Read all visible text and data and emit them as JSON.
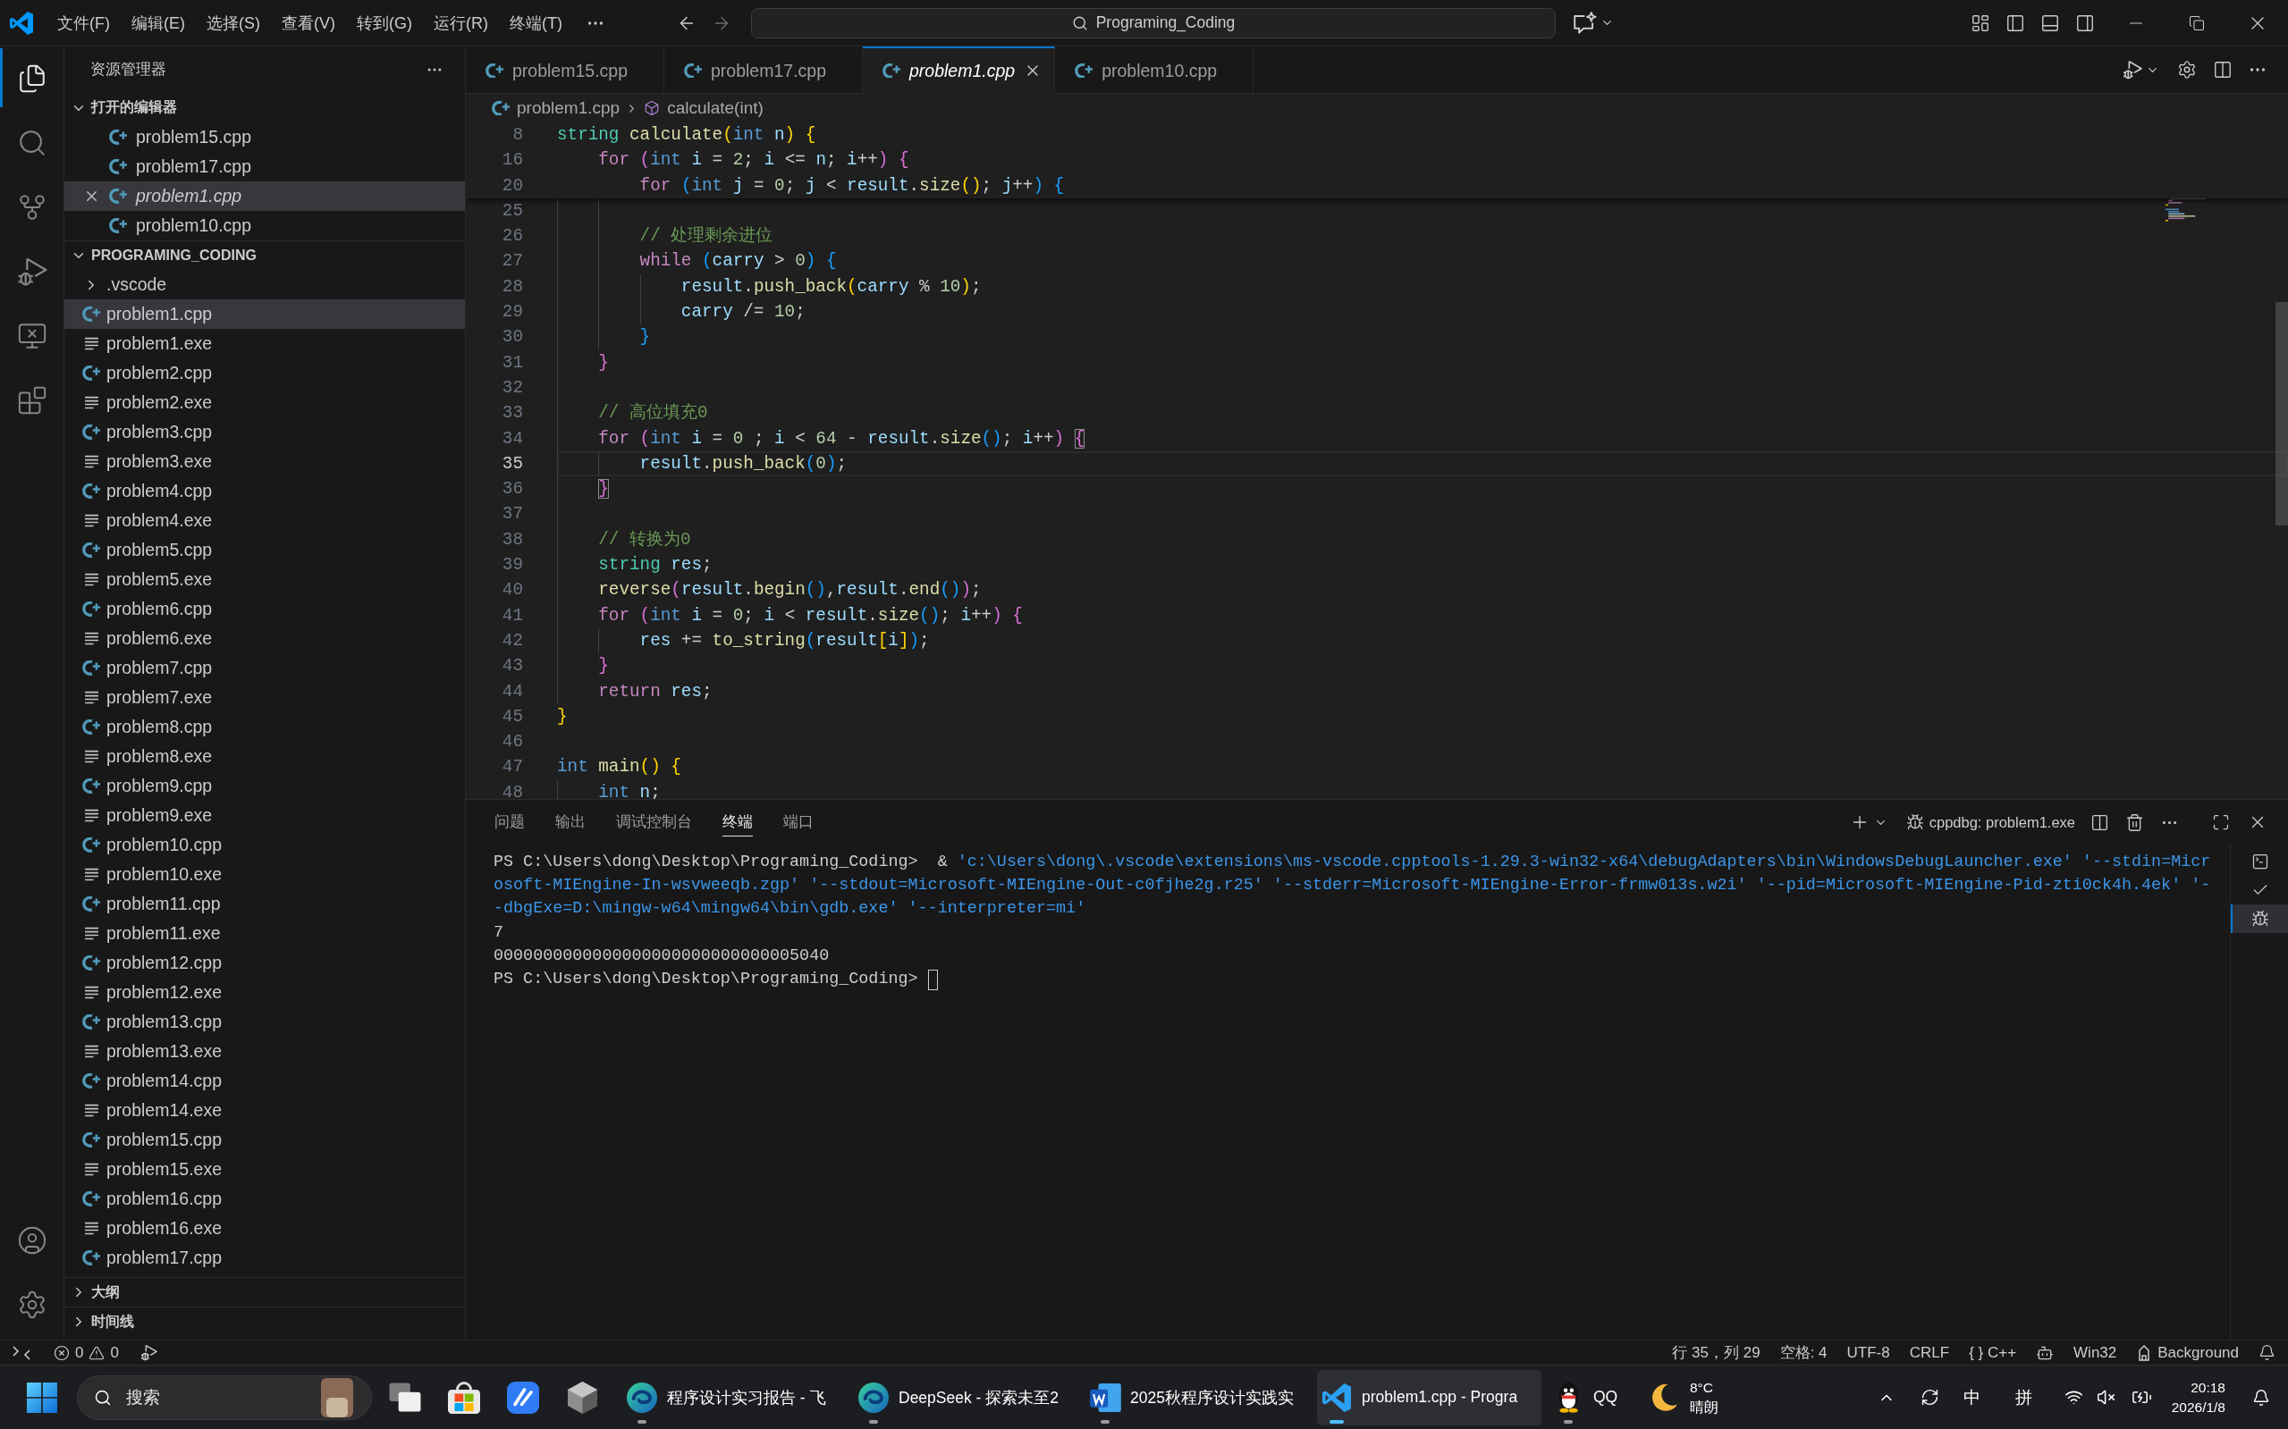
{
  "title_bar": {
    "menus": [
      "文件(F)",
      "编辑(E)",
      "选择(S)",
      "查看(V)",
      "转到(G)",
      "运行(R)",
      "终端(T)"
    ],
    "search": {
      "value": "Programing_Coding"
    }
  },
  "activity_bar": {
    "top": [
      {
        "kind": "explorer",
        "selected": true
      },
      {
        "kind": "search",
        "selected": false
      },
      {
        "kind": "source_control",
        "selected": false
      },
      {
        "kind": "run_debug",
        "selected": false
      },
      {
        "kind": "remote_explorer",
        "selected": false
      },
      {
        "kind": "extensions",
        "selected": false
      }
    ],
    "bottom": [
      {
        "kind": "accounts"
      },
      {
        "kind": "settings"
      }
    ]
  },
  "sidebar": {
    "title": "资源管理器",
    "open_editors": {
      "title": "打开的编辑器",
      "expanded": true,
      "items": [
        {
          "name": "problem15.cpp",
          "selected": false,
          "preview": false
        },
        {
          "name": "problem17.cpp",
          "selected": false,
          "preview": false
        },
        {
          "name": "problem1.cpp",
          "selected": true,
          "preview": true
        },
        {
          "name": "problem10.cpp",
          "selected": false,
          "preview": false
        }
      ]
    },
    "folder": {
      "title": "PROGRAMING_CODING",
      "expanded": true,
      "children": [
        {
          "name": ".vscode",
          "kind": "folder",
          "expanded": false,
          "selected": false
        },
        {
          "name": "problem1.cpp",
          "kind": "cpp",
          "selected": true
        },
        {
          "name": "problem1.exe",
          "kind": "exe",
          "selected": false
        },
        {
          "name": "problem2.cpp",
          "kind": "cpp",
          "selected": false
        },
        {
          "name": "problem2.exe",
          "kind": "exe",
          "selected": false
        },
        {
          "name": "problem3.cpp",
          "kind": "cpp",
          "selected": false
        },
        {
          "name": "problem3.exe",
          "kind": "exe",
          "selected": false
        },
        {
          "name": "problem4.cpp",
          "kind": "cpp",
          "selected": false
        },
        {
          "name": "problem4.exe",
          "kind": "exe",
          "selected": false
        },
        {
          "name": "problem5.cpp",
          "kind": "cpp",
          "selected": false
        },
        {
          "name": "problem5.exe",
          "kind": "exe",
          "selected": false
        },
        {
          "name": "problem6.cpp",
          "kind": "cpp",
          "selected": false
        },
        {
          "name": "problem6.exe",
          "kind": "exe",
          "selected": false
        },
        {
          "name": "problem7.cpp",
          "kind": "cpp",
          "selected": false
        },
        {
          "name": "problem7.exe",
          "kind": "exe",
          "selected": false
        },
        {
          "name": "problem8.cpp",
          "kind": "cpp",
          "selected": false
        },
        {
          "name": "problem8.exe",
          "kind": "exe",
          "selected": false
        },
        {
          "name": "problem9.cpp",
          "kind": "cpp",
          "selected": false
        },
        {
          "name": "problem9.exe",
          "kind": "exe",
          "selected": false
        },
        {
          "name": "problem10.cpp",
          "kind": "cpp",
          "selected": false
        },
        {
          "name": "problem10.exe",
          "kind": "exe",
          "selected": false
        },
        {
          "name": "problem11.cpp",
          "kind": "cpp",
          "selected": false
        },
        {
          "name": "problem11.exe",
          "kind": "exe",
          "selected": false
        },
        {
          "name": "problem12.cpp",
          "kind": "cpp",
          "selected": false
        },
        {
          "name": "problem12.exe",
          "kind": "exe",
          "selected": false
        },
        {
          "name": "problem13.cpp",
          "kind": "cpp",
          "selected": false
        },
        {
          "name": "problem13.exe",
          "kind": "exe",
          "selected": false
        },
        {
          "name": "problem14.cpp",
          "kind": "cpp",
          "selected": false
        },
        {
          "name": "problem14.exe",
          "kind": "exe",
          "selected": false
        },
        {
          "name": "problem15.cpp",
          "kind": "cpp",
          "selected": false
        },
        {
          "name": "problem15.exe",
          "kind": "exe",
          "selected": false
        },
        {
          "name": "problem16.cpp",
          "kind": "cpp",
          "selected": false
        },
        {
          "name": "problem16.exe",
          "kind": "exe",
          "selected": false
        },
        {
          "name": "problem17.cpp",
          "kind": "cpp",
          "selected": false
        }
      ]
    },
    "sections": [
      {
        "title": "大纲",
        "expanded": false
      },
      {
        "title": "时间线",
        "expanded": false
      }
    ]
  },
  "editor": {
    "tabs": [
      {
        "name": "problem15.cpp",
        "selected": false,
        "preview": false
      },
      {
        "name": "problem17.cpp",
        "selected": false,
        "preview": false
      },
      {
        "name": "problem1.cpp",
        "selected": true,
        "preview": true
      },
      {
        "name": "problem10.cpp",
        "selected": false,
        "preview": false
      }
    ],
    "breadcrumb": [
      {
        "kind": "file",
        "text": "problem1.cpp"
      },
      {
        "kind": "symbol",
        "text": "calculate(int)"
      }
    ],
    "sticky_lines": [
      {
        "number": "8",
        "current": false,
        "tokens": [
          {
            "text": "string ",
            "kind": "class"
          },
          {
            "text": "calculate",
            "kind": "function"
          },
          {
            "text": "(",
            "kind": "bracket1"
          },
          {
            "text": "int ",
            "kind": "type"
          },
          {
            "text": "n",
            "kind": "variable"
          },
          {
            "text": ") {",
            "kind": "bracket1"
          }
        ]
      },
      {
        "number": "16",
        "current": false,
        "tokens": [
          {
            "text": "    for ",
            "kind": "keyword"
          },
          {
            "text": "(",
            "kind": "bracket2"
          },
          {
            "text": "int ",
            "kind": "type"
          },
          {
            "text": "i",
            "kind": "variable"
          },
          {
            "text": " = ",
            "kind": "plain"
          },
          {
            "text": "2",
            "kind": "number"
          },
          {
            "text": "; ",
            "kind": "plain"
          },
          {
            "text": "i",
            "kind": "variable"
          },
          {
            "text": " <= ",
            "kind": "plain"
          },
          {
            "text": "n",
            "kind": "variable"
          },
          {
            "text": "; ",
            "kind": "plain"
          },
          {
            "text": "i",
            "kind": "variable"
          },
          {
            "text": "++",
            "kind": "plain"
          },
          {
            "text": ") {",
            "kind": "bracket2"
          }
        ]
      },
      {
        "number": "20",
        "current": false,
        "tokens": [
          {
            "text": "        for ",
            "kind": "keyword"
          },
          {
            "text": "(",
            "kind": "bracket3"
          },
          {
            "text": "int ",
            "kind": "type"
          },
          {
            "text": "j",
            "kind": "variable"
          },
          {
            "text": " = ",
            "kind": "plain"
          },
          {
            "text": "0",
            "kind": "number"
          },
          {
            "text": "; ",
            "kind": "plain"
          },
          {
            "text": "j",
            "kind": "variable"
          },
          {
            "text": " < ",
            "kind": "plain"
          },
          {
            "text": "result",
            "kind": "variable"
          },
          {
            "text": ".",
            "kind": "plain"
          },
          {
            "text": "size",
            "kind": "function"
          },
          {
            "text": "()",
            "kind": "bracket1"
          },
          {
            "text": "; ",
            "kind": "plain"
          },
          {
            "text": "j",
            "kind": "variable"
          },
          {
            "text": "++",
            "kind": "plain"
          },
          {
            "text": ") {",
            "kind": "bracket3"
          }
        ]
      }
    ],
    "lines": [
      {
        "number": "25",
        "current": false
      },
      {
        "number": "26",
        "current": false,
        "tokens": [
          {
            "text": "        // 处理剩余进位",
            "kind": "comment"
          }
        ]
      },
      {
        "number": "27",
        "current": false,
        "tokens": [
          {
            "text": "        while ",
            "kind": "keyword"
          },
          {
            "text": "(",
            "kind": "bracket3"
          },
          {
            "text": "carry",
            "kind": "variable"
          },
          {
            "text": " > ",
            "kind": "plain"
          },
          {
            "text": "0",
            "kind": "number"
          },
          {
            "text": ") {",
            "kind": "bracket3"
          }
        ]
      },
      {
        "number": "28",
        "current": false,
        "tokens": [
          {
            "text": "            result",
            "kind": "variable"
          },
          {
            "text": ".",
            "kind": "plain"
          },
          {
            "text": "push_back",
            "kind": "function"
          },
          {
            "text": "(",
            "kind": "bracket1"
          },
          {
            "text": "carry",
            "kind": "variable"
          },
          {
            "text": " % ",
            "kind": "plain"
          },
          {
            "text": "10",
            "kind": "number"
          },
          {
            "text": ")",
            "kind": "bracket1"
          },
          {
            "text": ";",
            "kind": "plain"
          }
        ]
      },
      {
        "number": "29",
        "current": false,
        "tokens": [
          {
            "text": "            carry",
            "kind": "variable"
          },
          {
            "text": " /= ",
            "kind": "plain"
          },
          {
            "text": "10",
            "kind": "number"
          },
          {
            "text": ";",
            "kind": "plain"
          }
        ]
      },
      {
        "number": "30",
        "current": false,
        "tokens": [
          {
            "text": "        }",
            "kind": "bracket3"
          }
        ]
      },
      {
        "number": "31",
        "current": false,
        "tokens": [
          {
            "text": "    }",
            "kind": "bracket2"
          }
        ]
      },
      {
        "number": "32",
        "current": false
      },
      {
        "number": "33",
        "current": false,
        "tokens": [
          {
            "text": "    // 高位填充0",
            "kind": "comment"
          }
        ]
      },
      {
        "number": "34",
        "current": false,
        "tokens": [
          {
            "text": "    for ",
            "kind": "keyword"
          },
          {
            "text": "(",
            "kind": "bracket2"
          },
          {
            "text": "int ",
            "kind": "type"
          },
          {
            "text": "i",
            "kind": "variable"
          },
          {
            "text": " = ",
            "kind": "plain"
          },
          {
            "text": "0",
            "kind": "number"
          },
          {
            "text": " ; ",
            "kind": "plain"
          },
          {
            "text": "i",
            "kind": "variable"
          },
          {
            "text": " < ",
            "kind": "plain"
          },
          {
            "text": "64",
            "kind": "number"
          },
          {
            "text": " - ",
            "kind": "plain"
          },
          {
            "text": "result",
            "kind": "variable"
          },
          {
            "text": ".",
            "kind": "plain"
          },
          {
            "text": "size",
            "kind": "function"
          },
          {
            "text": "()",
            "kind": "bracket3"
          },
          {
            "text": "; ",
            "kind": "plain"
          },
          {
            "text": "i",
            "kind": "variable"
          },
          {
            "text": "++",
            "kind": "plain"
          },
          {
            "text": ") ",
            "kind": "bracket2"
          },
          {
            "text": "{",
            "kind": "bracket2_match"
          }
        ]
      },
      {
        "number": "35",
        "current": true,
        "tokens": [
          {
            "text": "        result",
            "kind": "variable"
          },
          {
            "text": ".",
            "kind": "plain"
          },
          {
            "text": "push_back",
            "kind": "function"
          },
          {
            "text": "(",
            "kind": "bracket3"
          },
          {
            "text": "0",
            "kind": "number"
          },
          {
            "text": ")",
            "kind": "bracket3"
          },
          {
            "text": ";",
            "kind": "plain"
          }
        ]
      },
      {
        "number": "36",
        "current": false,
        "tokens": [
          {
            "text": "    }",
            "kind": "bracket2_match"
          }
        ]
      },
      {
        "number": "37",
        "current": false
      },
      {
        "number": "38",
        "current": false,
        "tokens": [
          {
            "text": "    // 转换为0",
            "kind": "comment"
          }
        ]
      },
      {
        "number": "39",
        "current": false,
        "tokens": [
          {
            "text": "    string ",
            "kind": "class"
          },
          {
            "text": "res",
            "kind": "variable"
          },
          {
            "text": ";",
            "kind": "plain"
          }
        ]
      },
      {
        "number": "40",
        "current": false,
        "tokens": [
          {
            "text": "    reverse",
            "kind": "function"
          },
          {
            "text": "(",
            "kind": "bracket2"
          },
          {
            "text": "result",
            "kind": "variable"
          },
          {
            "text": ".",
            "kind": "plain"
          },
          {
            "text": "begin",
            "kind": "function"
          },
          {
            "text": "()",
            "kind": "bracket3"
          },
          {
            "text": ",",
            "kind": "plain"
          },
          {
            "text": "result",
            "kind": "variable"
          },
          {
            "text": ".",
            "kind": "plain"
          },
          {
            "text": "end",
            "kind": "function"
          },
          {
            "text": "()",
            "kind": "bracket3"
          },
          {
            "text": ")",
            "kind": "bracket2"
          },
          {
            "text": ";",
            "kind": "plain"
          }
        ]
      },
      {
        "number": "41",
        "current": false,
        "tokens": [
          {
            "text": "    for ",
            "kind": "keyword"
          },
          {
            "text": "(",
            "kind": "bracket2"
          },
          {
            "text": "int ",
            "kind": "type"
          },
          {
            "text": "i",
            "kind": "variable"
          },
          {
            "text": " = ",
            "kind": "plain"
          },
          {
            "text": "0",
            "kind": "number"
          },
          {
            "text": "; ",
            "kind": "plain"
          },
          {
            "text": "i",
            "kind": "variable"
          },
          {
            "text": " < ",
            "kind": "plain"
          },
          {
            "text": "result",
            "kind": "variable"
          },
          {
            "text": ".",
            "kind": "plain"
          },
          {
            "text": "size",
            "kind": "function"
          },
          {
            "text": "()",
            "kind": "bracket3"
          },
          {
            "text": "; ",
            "kind": "plain"
          },
          {
            "text": "i",
            "kind": "variable"
          },
          {
            "text": "++",
            "kind": "plain"
          },
          {
            "text": ") {",
            "kind": "bracket2"
          }
        ]
      },
      {
        "number": "42",
        "current": false,
        "tokens": [
          {
            "text": "        res",
            "kind": "variable"
          },
          {
            "text": " += ",
            "kind": "plain"
          },
          {
            "text": "to_string",
            "kind": "function"
          },
          {
            "text": "(",
            "kind": "bracket3"
          },
          {
            "text": "result",
            "kind": "variable"
          },
          {
            "text": "[",
            "kind": "bracket1"
          },
          {
            "text": "i",
            "kind": "variable"
          },
          {
            "text": "]",
            "kind": "bracket1"
          },
          {
            "text": ")",
            "kind": "bracket3"
          },
          {
            "text": ";",
            "kind": "plain"
          }
        ]
      },
      {
        "number": "43",
        "current": false,
        "tokens": [
          {
            "text": "    }",
            "kind": "bracket2"
          }
        ]
      },
      {
        "number": "44",
        "current": false,
        "tokens": [
          {
            "text": "    return ",
            "kind": "keyword"
          },
          {
            "text": "res",
            "kind": "variable"
          },
          {
            "text": ";",
            "kind": "plain"
          }
        ]
      },
      {
        "number": "45",
        "current": false,
        "tokens": [
          {
            "text": "}",
            "kind": "bracket1"
          }
        ]
      },
      {
        "number": "46",
        "current": false
      },
      {
        "number": "47",
        "current": false,
        "tokens": [
          {
            "text": "int ",
            "kind": "type"
          },
          {
            "text": "main",
            "kind": "function"
          },
          {
            "text": "() {",
            "kind": "bracket1"
          }
        ]
      },
      {
        "number": "48",
        "current": false,
        "tokens": [
          {
            "text": "    int ",
            "kind": "type"
          },
          {
            "text": "n",
            "kind": "variable"
          },
          {
            "text": ";",
            "kind": "plain"
          }
        ]
      }
    ]
  },
  "panel": {
    "tabs": [
      {
        "label": "问题",
        "selected": false
      },
      {
        "label": "输出",
        "selected": false
      },
      {
        "label": "调试控制台",
        "selected": false
      },
      {
        "label": "终端",
        "selected": true
      },
      {
        "label": "端口",
        "selected": false
      }
    ],
    "terminal_name": "cppdbg: problem1.exe",
    "terminal_lines": [
      {
        "cursor": false,
        "segments": [
          {
            "text": "PS C:\\Users\\dong\\Desktop\\Programing_Coding>",
            "kind": "prompt"
          },
          {
            "text": "  & ",
            "kind": "plain"
          },
          {
            "text": "'c:\\Users\\dong\\.vscode\\extensions\\ms-vscode.cpptools-1.29.3-win32-x64\\debugAdapters\\bin\\WindowsDebugLauncher.exe' '--stdin=Micr",
            "kind": "string"
          }
        ]
      },
      {
        "cursor": false,
        "segments": [
          {
            "text": "osoft-MIEngine-In-wsvweeqb.zgp' '--stdout=Microsoft-MIEngine-Out-c0fjhe2g.r25' '--stderr=Microsoft-MIEngine-Error-frmw013s.w2i' '--pid=Microsoft-MIEngine-Pid-zti0ck4h.4ek' '-",
            "kind": "string"
          }
        ]
      },
      {
        "cursor": false,
        "segments": [
          {
            "text": "-dbgExe=D:\\mingw-w64\\mingw64\\bin\\gdb.exe' '--interpreter=mi'",
            "kind": "string"
          }
        ]
      },
      {
        "cursor": false,
        "segments": [
          {
            "text": "7",
            "kind": "plain"
          }
        ]
      },
      {
        "cursor": false,
        "segments": [
          {
            "text": "0000000000000000000000000000005040",
            "kind": "plain"
          }
        ]
      },
      {
        "cursor": true,
        "segments": [
          {
            "text": "PS C:\\Users\\dong\\Desktop\\Programing_Coding>",
            "kind": "prompt"
          }
        ]
      }
    ],
    "terminals": [
      {
        "kind": "shell",
        "selected": false
      },
      {
        "kind": "task",
        "selected": false
      },
      {
        "kind": "debug",
        "selected": true
      }
    ]
  },
  "status_bar": {
    "errors": "0",
    "warnings": "0",
    "items": [
      {
        "kind": "text",
        "text": "行 35，列 29"
      },
      {
        "kind": "text",
        "text": "空格: 4"
      },
      {
        "kind": "text",
        "text": "UTF-8"
      },
      {
        "kind": "text",
        "text": "CRLF"
      },
      {
        "kind": "text",
        "text": "{ } C++"
      },
      {
        "kind": "copilot"
      },
      {
        "kind": "text",
        "text": "Win32"
      },
      {
        "kind": "background",
        "text": "Background"
      },
      {
        "kind": "notifications"
      }
    ]
  },
  "taskbar": {
    "search": {
      "placeholder": "搜索"
    },
    "apps": [
      {
        "kind": "task_view",
        "running": false,
        "selected": false
      },
      {
        "kind": "store",
        "running": false,
        "selected": false
      },
      {
        "kind": "tile",
        "running": false,
        "selected": false
      },
      {
        "kind": "hexagon",
        "running": false,
        "selected": false
      },
      {
        "kind": "swirl",
        "label": "程序设计实习报告 - 飞",
        "running": true,
        "selected": false
      },
      {
        "kind": "swirl",
        "label": "DeepSeek - 探索未至2",
        "running": true,
        "selected": false
      },
      {
        "kind": "document",
        "label": "2025秋程序设计实践实",
        "running": true,
        "selected": false
      },
      {
        "kind": "ribbon",
        "label": "problem1.cpp - Progra",
        "running": true,
        "selected": true
      },
      {
        "kind": "penguin",
        "label": "QQ",
        "running": true,
        "selected": false
      }
    ],
    "weather": {
      "temperature": "8°C",
      "condition": "晴朗"
    },
    "input_method": {
      "language": "中",
      "mode": "拼"
    },
    "clock": {
      "time": "20:18",
      "date": "2026/1/8"
    }
  }
}
